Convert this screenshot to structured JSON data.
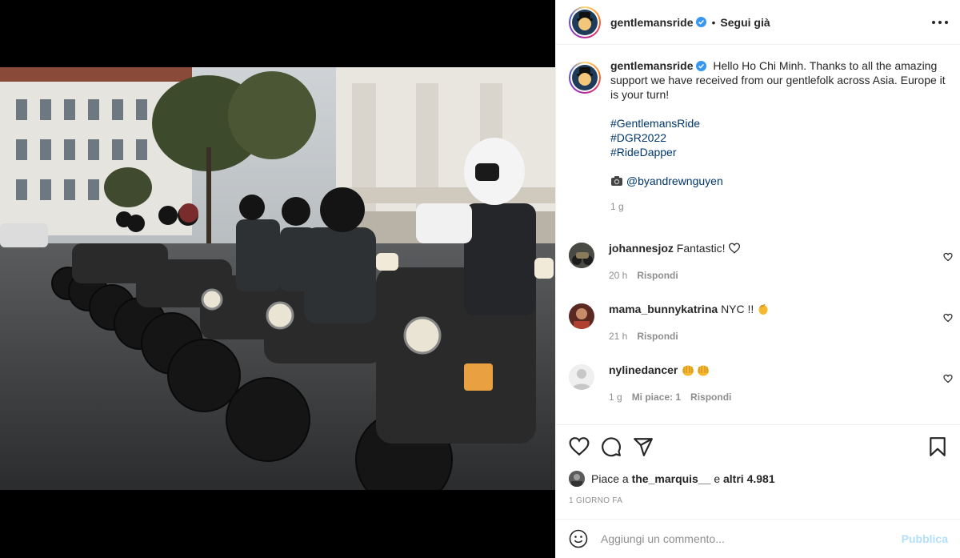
{
  "post": {
    "author": "gentlemansride",
    "follow_label": "Segui già",
    "verified": true
  },
  "caption": {
    "username": "gentlemansride",
    "text_line1": "Hello Ho Chi Minh. Thanks to all the amazing",
    "text_line2": "support we have received from our gentlefolk across Asia. Europe it",
    "text_line3": "is your turn!",
    "hashtags": [
      "#GentlemansRide",
      "#DGR2022",
      "#RideDapper"
    ],
    "credit_icon": "camera-emoji",
    "credit": "@byandrewnguyen",
    "time": "1 g"
  },
  "comments": [
    {
      "username": "johannesjoz",
      "text": "Fantastic!",
      "time": "20 h",
      "reply_label": "Rispondi"
    },
    {
      "username": "mama_bunnykatrina",
      "text": "NYC !!",
      "time": "21 h",
      "reply_label": "Rispondi"
    },
    {
      "username": "nylinedancer",
      "text": "",
      "time": "1 g",
      "likes_label": "Mi piace: 1",
      "reply_label": "Rispondi"
    }
  ],
  "likes": {
    "prefix": "Piace a",
    "user": "the_marquis__",
    "connector": "e",
    "others": "altri 4.981"
  },
  "date": "1 GIORNO FA",
  "add_comment": {
    "placeholder": "Aggiungi un commento...",
    "publish_label": "Pubblica"
  },
  "colors": {
    "link": "#00376b",
    "muted": "#8e8e8e",
    "verified": "#3897f0",
    "publish_disabled": "#b2dffc"
  }
}
